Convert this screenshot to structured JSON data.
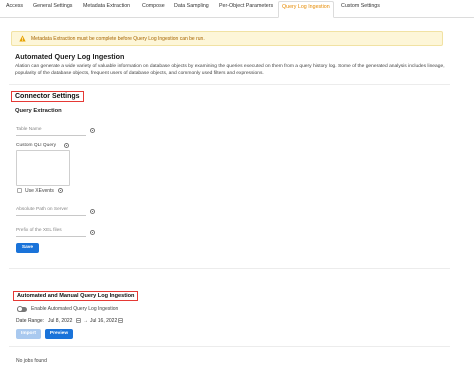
{
  "tabs": [
    {
      "label": "Access",
      "active": false
    },
    {
      "label": "General Settings",
      "active": false
    },
    {
      "label": "Metadata Extraction",
      "active": false
    },
    {
      "label": "Compose",
      "active": false
    },
    {
      "label": "Data Sampling",
      "active": false
    },
    {
      "label": "Per-Object Parameters",
      "active": false
    },
    {
      "label": "Query Log Ingestion",
      "active": true
    },
    {
      "label": "Custom Settings",
      "active": false
    }
  ],
  "alert": {
    "text": "Metadata Extraction must be complete before Query Log Ingestion can be run.",
    "icon": "warning-icon",
    "color": "#a66400"
  },
  "page": {
    "title": "Automated Query Log Ingestion",
    "description": "Alation can generate a wide variety of valuable information on database objects by examining the queries executed on them from a query history log. Some of the generated analysis includes lineage, popularity of the database objects, frequent users of database objects, and commonly used filters and expressions."
  },
  "connector_settings": {
    "heading": "Connector Settings",
    "subheading": "Query Extraction",
    "fields": {
      "table_name": {
        "label": "Table Name",
        "value": ""
      },
      "custom_qli": {
        "label": "Custom QLI Query",
        "value": ""
      },
      "use_xevents": {
        "label": "Use XEvents",
        "checked": false
      },
      "absolute_path": {
        "label": "Absolute Path on Server",
        "value": ""
      },
      "prefix": {
        "label": "Prefix of the XEL files",
        "value": ""
      }
    },
    "save_label": "Save"
  },
  "automated_manual": {
    "heading": "Automated and Manual Query Log Ingestion",
    "toggle_label": "Enable Automated Query Log Ingestion",
    "toggle_on": false,
    "date_range_label": "Date Range:",
    "date_start": "Jul 8, 2022",
    "date_separator": "→",
    "date_end": "Jul 16, 2022",
    "import_label": "Import",
    "preview_label": "Preview"
  },
  "jobs": {
    "empty_text": "No jobs found"
  },
  "colors": {
    "accent": "#1a73d9",
    "active_tab": "#e68a00",
    "highlight_border": "#e53935",
    "alert_bg": "#fdf6d8"
  }
}
